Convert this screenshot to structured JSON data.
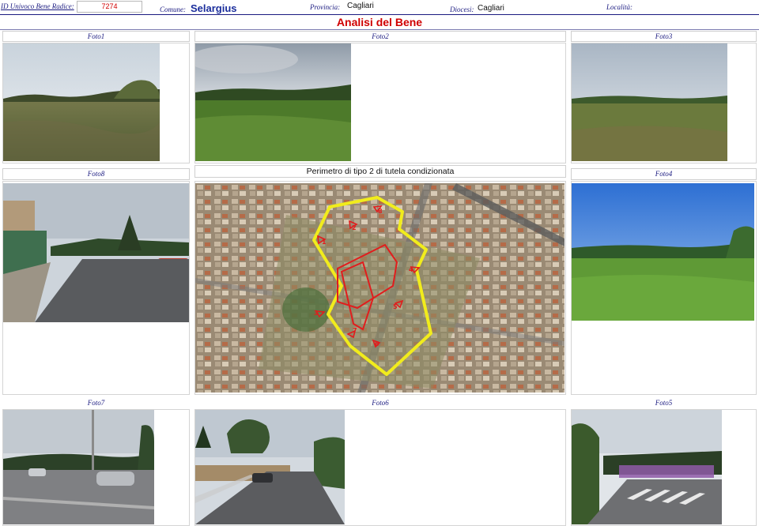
{
  "header": {
    "id_label": "ID Univoco Bene Radice:",
    "id_value": "7274",
    "comune_label": "Comune:",
    "comune_value": "Selargius",
    "provincia_label": "Provincia:",
    "provincia_value": "Cagliari",
    "diocesi_label": "Diocesi:",
    "diocesi_value": "Cagliari",
    "localita_label": "Località:",
    "localita_value": ""
  },
  "title": "Analisi del Bene",
  "photos": {
    "foto1": "Foto1",
    "foto2": "Foto2",
    "foto3": "Foto3",
    "foto4": "Foto4",
    "foto5": "Foto5",
    "foto6": "Foto6",
    "foto7": "Foto7",
    "foto8": "Foto8"
  },
  "map": {
    "caption": "Perimetro di tipo 2 di tutela condizionata",
    "markers": [
      "1",
      "2",
      "3",
      "4",
      "5",
      "6",
      "7",
      "8"
    ]
  }
}
